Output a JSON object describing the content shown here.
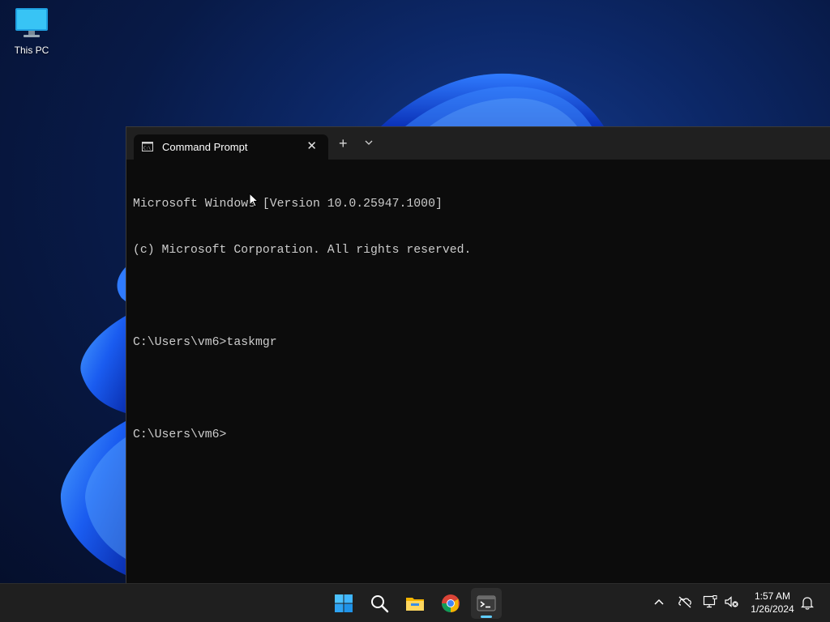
{
  "desktop": {
    "icons": [
      {
        "label": "This PC",
        "icon": "monitor-icon"
      }
    ]
  },
  "window": {
    "tab_title": "Command Prompt",
    "tab_icon": "cmd-icon",
    "close_glyph": "✕",
    "new_tab_glyph": "+",
    "console_lines": [
      "Microsoft Windows [Version 10.0.25947.1000]",
      "(c) Microsoft Corporation. All rights reserved.",
      "",
      "C:\\Users\\vm6>taskmgr",
      "",
      "C:\\Users\\vm6>"
    ]
  },
  "taskbar": {
    "apps": [
      "start-icon",
      "search-icon",
      "file-explorer-icon",
      "chrome-icon",
      "terminal-icon"
    ],
    "active_app": "terminal-icon",
    "tray": [
      "chevron-up-icon",
      "cloud-offline-icon",
      "network-icon",
      "speaker-muted-icon"
    ],
    "time": "1:57 AM",
    "date": "1/26/2024",
    "notification_icon": "bell-icon"
  },
  "colors": {
    "accent": "#60cdff",
    "console_bg": "#0c0c0c",
    "console_fg": "#cccccc",
    "taskbar_bg": "#1f1f1f"
  }
}
